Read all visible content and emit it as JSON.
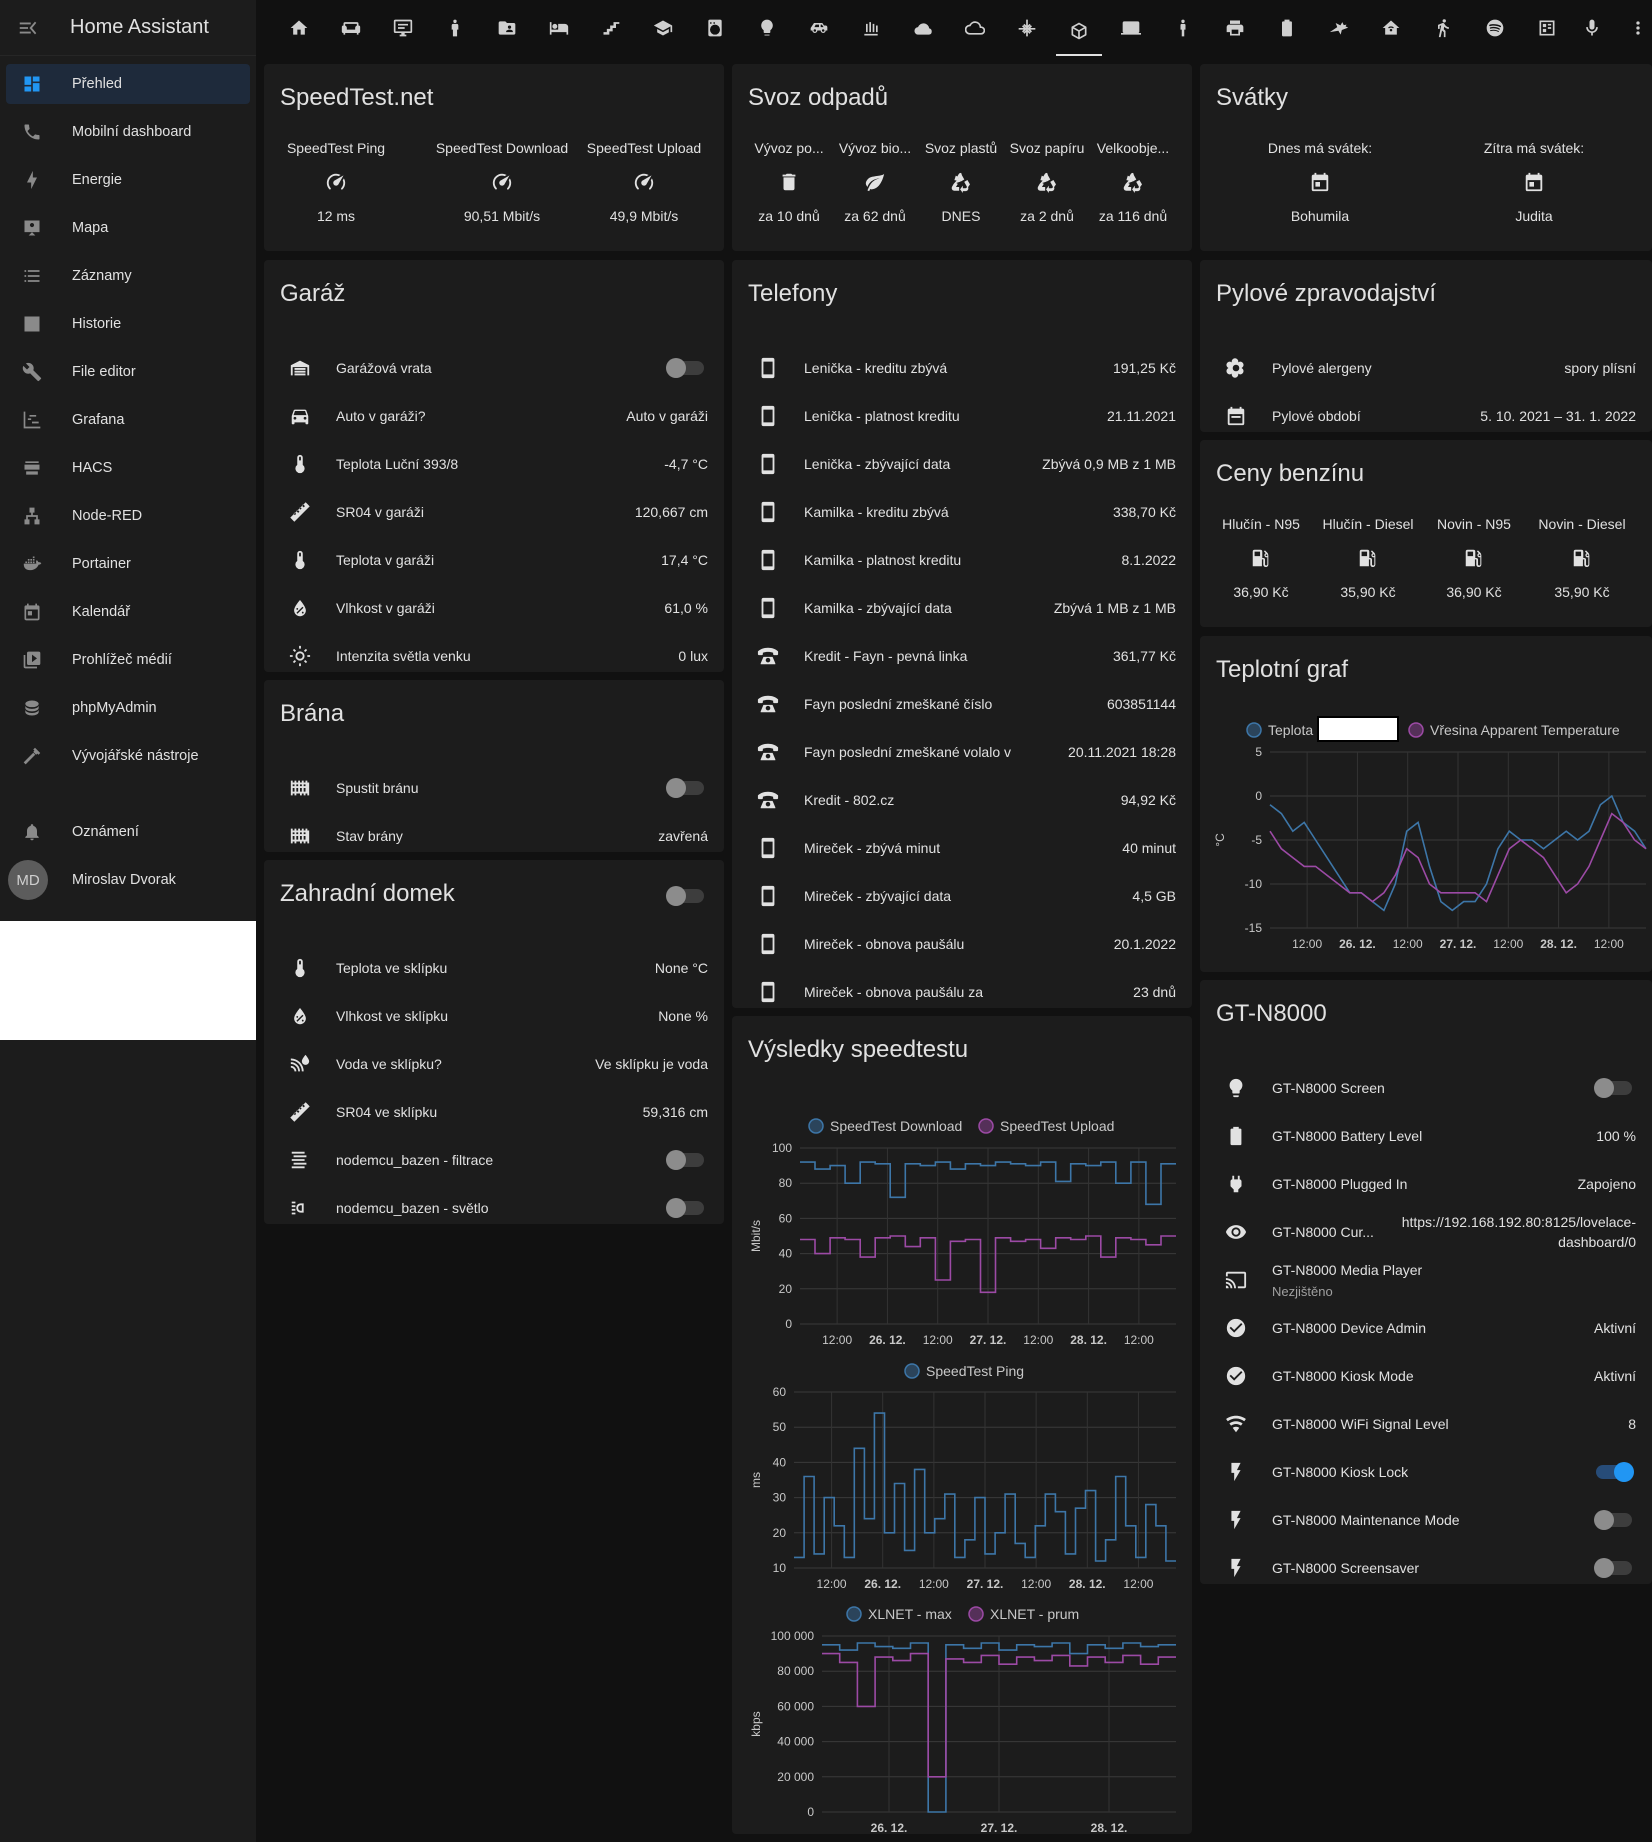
{
  "app": {
    "title": "Home Assistant"
  },
  "sidebar": {
    "items": [
      {
        "label": "Přehled",
        "icon": "dashboard-icon"
      },
      {
        "label": "Mobilní dashboard",
        "icon": "phone-icon"
      },
      {
        "label": "Energie",
        "icon": "lightning-icon"
      },
      {
        "label": "Mapa",
        "icon": "map-account-icon"
      },
      {
        "label": "Záznamy",
        "icon": "list-icon"
      },
      {
        "label": "Historie",
        "icon": "chart-box-icon"
      },
      {
        "label": "File editor",
        "icon": "wrench-icon"
      },
      {
        "label": "Grafana",
        "icon": "chart-timeline-icon"
      },
      {
        "label": "HACS",
        "icon": "hacs-icon"
      },
      {
        "label": "Node-RED",
        "icon": "sitemap-icon"
      },
      {
        "label": "Portainer",
        "icon": "docker-icon"
      },
      {
        "label": "Kalendář",
        "icon": "calendar-icon"
      },
      {
        "label": "Prohlížeč médií",
        "icon": "media-play-icon"
      },
      {
        "label": "phpMyAdmin",
        "icon": "database-icon"
      },
      {
        "label": "Vývojářské nástroje",
        "icon": "hammer-icon"
      }
    ],
    "notifications": "Oznámení",
    "user": {
      "initials": "MD",
      "name": "Miroslav Dvorak"
    }
  },
  "speedtest": {
    "title": "SpeedTest.net",
    "items": [
      {
        "name": "SpeedTest Ping",
        "value": "12 ms"
      },
      {
        "name": "SpeedTest Download",
        "value": "90,51 Mbit/s"
      },
      {
        "name": "SpeedTest Upload",
        "value": "49,9 Mbit/s"
      }
    ]
  },
  "garaz": {
    "title": "Garáž",
    "rows": [
      {
        "name": "Garážová vrata",
        "value": "",
        "icon": "garage-icon"
      },
      {
        "name": "Auto v garáži?",
        "value": "Auto v garáži",
        "icon": "car-icon"
      },
      {
        "name": "Teplota Luční 393/8",
        "value": "-4,7 °C",
        "icon": "thermometer-icon"
      },
      {
        "name": "SR04 v garáži",
        "value": "120,667 cm",
        "icon": "ruler-icon"
      },
      {
        "name": "Teplota v garáži",
        "value": "17,4 °C",
        "icon": "thermometer-icon"
      },
      {
        "name": "Vlhkost v garáži",
        "value": "61,0 %",
        "icon": "water-percent-icon"
      },
      {
        "name": "Intenzita světla venku",
        "value": "0 lux",
        "icon": "brightness-icon"
      }
    ]
  },
  "brana": {
    "title": "Brána",
    "rows": [
      {
        "name": "Spustit bránu",
        "value": "",
        "icon": "gate-icon"
      },
      {
        "name": "Stav brány",
        "value": "zavřená",
        "icon": "gate-icon"
      }
    ]
  },
  "zahradni": {
    "title": "Zahradní domek",
    "rows": [
      {
        "name": "Teplota ve sklípku",
        "value": "None °C",
        "icon": "thermometer-icon"
      },
      {
        "name": "Vlhkost ve sklípku",
        "value": "None %",
        "icon": "water-percent-icon"
      },
      {
        "name": "Voda ve sklípku?",
        "value": "Ve sklípku je voda",
        "icon": "water-sensor-icon"
      },
      {
        "name": "SR04 ve sklípku",
        "value": "59,316 cm",
        "icon": "ruler-icon"
      },
      {
        "name": "nodemcu_bazen - filtrace",
        "value": "",
        "icon": "filter-icon"
      },
      {
        "name": "nodemcu_bazen - světlo",
        "value": "",
        "icon": "light-icon"
      }
    ]
  },
  "svoz": {
    "title": "Svoz odpadů",
    "items": [
      {
        "name": "Vývoz po...",
        "value": "za 10 dnů",
        "icon": "trash-icon"
      },
      {
        "name": "Vývoz bio...",
        "value": "za 62 dnů",
        "icon": "leaf-icon"
      },
      {
        "name": "Svoz plastů",
        "value": "DNES",
        "icon": "recycle-icon"
      },
      {
        "name": "Svoz papíru",
        "value": "za 2 dnů",
        "icon": "recycle-icon"
      },
      {
        "name": "Velkoobje...",
        "value": "za 116 dnů",
        "icon": "recycle-icon"
      }
    ]
  },
  "telefony": {
    "title": "Telefony",
    "rows": [
      {
        "name": "Lenička - kreditu zbývá",
        "value": "191,25 Kč",
        "icon": "cellphone-icon"
      },
      {
        "name": "Lenička - platnost kreditu",
        "value": "21.11.2021",
        "icon": "cellphone-icon"
      },
      {
        "name": "Lenička - zbývající data",
        "value": "Zbývá 0,9 MB z 1 MB",
        "icon": "cellphone-icon"
      },
      {
        "name": "Kamilka - kreditu zbývá",
        "value": "338,70 Kč",
        "icon": "cellphone-icon"
      },
      {
        "name": "Kamilka - platnost kreditu",
        "value": "8.1.2022",
        "icon": "cellphone-icon"
      },
      {
        "name": "Kamilka - zbývající data",
        "value": "Zbývá 1 MB z 1 MB",
        "icon": "cellphone-icon"
      },
      {
        "name": "Kredit - Fayn - pevná linka",
        "value": "361,77 Kč",
        "icon": "phone-classic-icon"
      },
      {
        "name": "Fayn poslední zmeškané číslo",
        "value": "603851144",
        "icon": "phone-classic-icon"
      },
      {
        "name": "Fayn poslední zmeškané volalo v",
        "value": "20.11.2021 18:28",
        "icon": "phone-classic-icon"
      },
      {
        "name": "Kredit - 802.cz",
        "value": "94,92 Kč",
        "icon": "phone-classic-icon"
      },
      {
        "name": "Mireček - zbývá minut",
        "value": "40 minut",
        "icon": "cellphone-icon"
      },
      {
        "name": "Mireček - zbývající data",
        "value": "4,5 GB",
        "icon": "cellphone-icon"
      },
      {
        "name": "Mireček - obnova paušálu",
        "value": "20.1.2022",
        "icon": "cellphone-icon"
      },
      {
        "name": "Mireček - obnova paušálu za",
        "value": "23 dnů",
        "icon": "cellphone-icon"
      }
    ]
  },
  "vysledky": {
    "title": "Výsledky speedtestu"
  },
  "svatky": {
    "title": "Svátky",
    "items": [
      {
        "name": "Dnes má svátek:",
        "value": "Bohumila"
      },
      {
        "name": "Zítra má svátek:",
        "value": "Judita"
      }
    ]
  },
  "pyl": {
    "title": "Pylové zpravodajství",
    "rows": [
      {
        "name": "Pylové alergeny",
        "value": "spory plísní",
        "icon": "flower-pollen-icon"
      },
      {
        "name": "Pylové období",
        "value": "5. 10. 2021 – 31. 1. 2022",
        "icon": "calendar-range-icon"
      }
    ]
  },
  "benzin": {
    "title": "Ceny benzínu",
    "items": [
      {
        "name": "Hlučín - N95",
        "value": "36,90 Kč"
      },
      {
        "name": "Hlučín - Diesel",
        "value": "35,90 Kč"
      },
      {
        "name": "Novin - N95",
        "value": "36,90 Kč"
      },
      {
        "name": "Novin - Diesel",
        "value": "35,90 Kč"
      }
    ]
  },
  "teplotni": {
    "title": "Teplotní graf"
  },
  "gtn": {
    "title": "GT-N8000",
    "rows": [
      {
        "name": "GT-N8000 Screen",
        "value": "",
        "icon": "lightbulb-icon"
      },
      {
        "name": "GT-N8000 Battery Level",
        "value": "100 %",
        "icon": "battery-icon"
      },
      {
        "name": "GT-N8000 Plugged In",
        "value": "Zapojeno",
        "icon": "power-plug-icon"
      },
      {
        "name": "GT-N8000 Cur...",
        "value": "https://192.168.192.80:8125/lovelace-dashboard/0",
        "icon": "eye-icon"
      },
      {
        "name": "GT-N8000 Media Player",
        "value": "Nezjištěno",
        "icon": "cast-icon"
      },
      {
        "name": "GT-N8000 Device Admin",
        "value": "Aktivní",
        "icon": "check-circle-icon"
      },
      {
        "name": "GT-N8000 Kiosk Mode",
        "value": "Aktivní",
        "icon": "check-circle-icon"
      },
      {
        "name": "GT-N8000 WiFi Signal Level",
        "value": "8",
        "icon": "wifi-icon"
      },
      {
        "name": "GT-N8000 Kiosk Lock",
        "value": "",
        "icon": "flash-icon"
      },
      {
        "name": "GT-N8000 Maintenance Mode",
        "value": "",
        "icon": "flash-icon"
      },
      {
        "name": "GT-N8000 Screensaver",
        "value": "",
        "icon": "flash-icon"
      }
    ]
  },
  "colors": {
    "accent": "#2196f3",
    "blue_series": "#3d76a8",
    "purple_series": "#9c4aa5"
  },
  "chart_data": [
    {
      "type": "line",
      "title": "",
      "ylabel": "Mbit/s",
      "ylim": [
        0,
        100
      ],
      "yticks": [
        "100",
        "80",
        "60",
        "40",
        "20",
        "0"
      ],
      "xticks": [
        "12:00",
        "26. 12.",
        "12:00",
        "27. 12.",
        "12:00",
        "28. 12.",
        "12:00"
      ],
      "series": [
        {
          "name": "SpeedTest Download",
          "values": [
            92,
            88,
            90,
            80,
            92,
            91,
            72,
            91,
            90,
            92,
            88,
            91,
            90,
            92,
            91,
            90,
            92,
            81,
            91,
            90,
            92,
            80,
            92,
            68,
            91
          ]
        },
        {
          "name": "SpeedTest Upload",
          "values": [
            48,
            40,
            49,
            48,
            38,
            49,
            50,
            44,
            49,
            25,
            47,
            48,
            18,
            49,
            47,
            48,
            43,
            49,
            48,
            50,
            38,
            49,
            48,
            45,
            50
          ]
        }
      ]
    },
    {
      "type": "line",
      "title": "",
      "ylabel": "ms",
      "ylim": [
        10,
        60
      ],
      "yticks": [
        "60",
        "50",
        "40",
        "30",
        "20",
        "10"
      ],
      "xticks": [
        "12:00",
        "26. 12.",
        "12:00",
        "27. 12.",
        "12:00",
        "28. 12.",
        "12:00"
      ],
      "series": [
        {
          "name": "SpeedTest Ping",
          "values": [
            13,
            36,
            14,
            30,
            22,
            13,
            44,
            24,
            54,
            20,
            34,
            15,
            38,
            20,
            24,
            31,
            13,
            18,
            30,
            14,
            20,
            31,
            17,
            13,
            22,
            31,
            26,
            14,
            27,
            32,
            12,
            18,
            36,
            22,
            13,
            28,
            22,
            12
          ]
        }
      ]
    },
    {
      "type": "line",
      "title": "",
      "ylabel": "kbps",
      "ylim": [
        0,
        100000
      ],
      "yticks": [
        "100 000",
        "80 000",
        "60 000",
        "40 000",
        "20 000",
        "0"
      ],
      "xticks": [
        "26. 12.",
        "27. 12.",
        "28. 12."
      ],
      "series": [
        {
          "name": "XLNET - max",
          "values": [
            95000,
            92000,
            96000,
            94000,
            93000,
            96000,
            0,
            95000,
            93000,
            96000,
            92000,
            95000,
            94000,
            96000,
            90000,
            95000,
            93000,
            96000,
            94000,
            95000
          ]
        },
        {
          "name": "XLNET - prum",
          "values": [
            90000,
            85000,
            60000,
            88000,
            86000,
            90000,
            20000,
            87000,
            85000,
            89000,
            84000,
            88000,
            86000,
            89000,
            83000,
            88000,
            85000,
            89000,
            84000,
            88000
          ]
        }
      ]
    },
    {
      "type": "line",
      "title": "",
      "ylabel": "°C",
      "ylim": [
        -15,
        5
      ],
      "yticks": [
        "5",
        "0",
        "-5",
        "-10",
        "-15"
      ],
      "xticks": [
        "12:00",
        "26. 12.",
        "12:00",
        "27. 12.",
        "12:00",
        "28. 12.",
        "12:00"
      ],
      "series": [
        {
          "name": "Teplota",
          "values": [
            -1,
            -2,
            -4,
            -3,
            -5,
            -7,
            -9,
            -11,
            -11,
            -12,
            -13,
            -10,
            -4,
            -3,
            -8,
            -12,
            -13,
            -12,
            -12,
            -10,
            -6,
            -4,
            -5,
            -5,
            -6,
            -5,
            -4,
            -5,
            -4,
            -1,
            0,
            -3,
            -4,
            -6
          ]
        },
        {
          "name": "Vřesina Apparent Temperature",
          "values": [
            -4,
            -6,
            -7,
            -8,
            -8,
            -9,
            -10,
            -11,
            -11,
            -12,
            -11,
            -9,
            -6,
            -7,
            -10,
            -11,
            -11,
            -11,
            -11,
            -12,
            -9,
            -6,
            -5,
            -6,
            -7,
            -9,
            -11,
            -10,
            -8,
            -5,
            -2,
            -3,
            -5,
            -6
          ]
        }
      ]
    }
  ]
}
